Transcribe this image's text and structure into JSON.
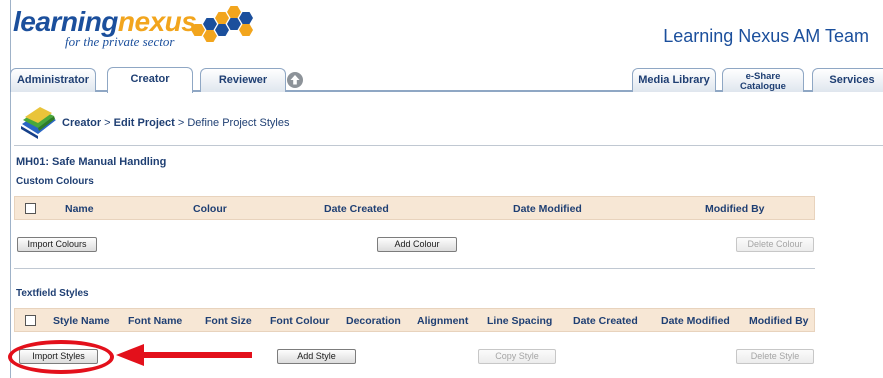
{
  "header": {
    "logo_part1": "learning",
    "logo_part2": "nexus",
    "logo_tagline": "for the private sector",
    "team_name": "Learning Nexus AM Team"
  },
  "tabs": {
    "administrator": "Administrator",
    "creator": "Creator",
    "reviewer": "Reviewer",
    "media_library": "Media Library",
    "eshare_line1": "e-Share",
    "eshare_line2": "Catalogue",
    "services": "Services"
  },
  "breadcrumb": {
    "creator": "Creator",
    "sep1": " > ",
    "edit_project": "Edit Project",
    "sep2": " > ",
    "current": "Define Project Styles"
  },
  "project_title": "MH01: Safe Manual Handling",
  "custom_colours": {
    "title": "Custom Colours",
    "columns": [
      "Name",
      "Colour",
      "Date Created",
      "Date Modified",
      "Modified By"
    ],
    "import_button": "Import Colours",
    "add_button": "Add Colour",
    "delete_button": "Delete Colour"
  },
  "textfield_styles": {
    "title": "Textfield Styles",
    "columns": [
      "Style Name",
      "Font Name",
      "Font Size",
      "Font Colour",
      "Decoration",
      "Alignment",
      "Line Spacing",
      "Date Created",
      "Date Modified",
      "Modified By"
    ],
    "import_button": "Import Styles",
    "add_button": "Add Style",
    "copy_button": "Copy Style",
    "delete_button": "Delete Style"
  },
  "colors": {
    "annotation_red": "#e3101b",
    "header_row": "#f7e7d5",
    "brand_blue": "#1b4f9c",
    "brand_orange": "#f2a51d"
  }
}
